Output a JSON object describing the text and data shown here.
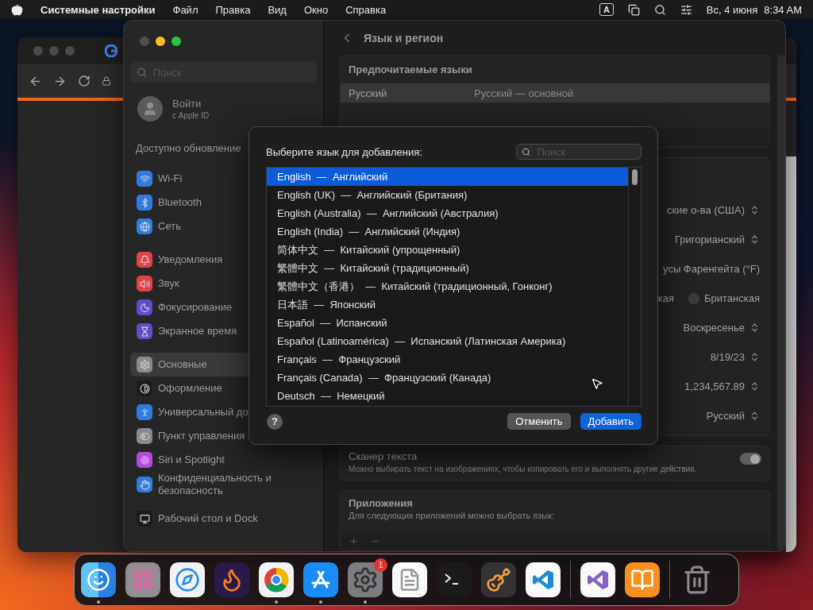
{
  "menu_bar": {
    "app": "Системные настройки",
    "menus": [
      "Файл",
      "Правка",
      "Вид",
      "Окно",
      "Справка"
    ],
    "input_source": "A",
    "date": "Вс, 4 июня",
    "time": "8:34 AM"
  },
  "settings": {
    "search": {
      "placeholder": "Поиск"
    },
    "account": {
      "title": "Войти",
      "subtitle": "с Apple ID"
    },
    "update_notice": "Доступно обновление",
    "sidebar_groups": [
      [
        {
          "label": "Wi-Fi",
          "color": "#2f7de1",
          "selected": false
        },
        {
          "label": "Bluetooth",
          "color": "#2f7de1",
          "selected": false
        },
        {
          "label": "Сеть",
          "color": "#2f7de1",
          "selected": false
        }
      ],
      [
        {
          "label": "Уведомления",
          "color": "#e0444a",
          "selected": false
        },
        {
          "label": "Звук",
          "color": "#e0444a",
          "selected": false
        },
        {
          "label": "Фокусирование",
          "color": "#5d4fc9",
          "selected": false
        },
        {
          "label": "Экранное время",
          "color": "#5d4fc9",
          "selected": false
        }
      ],
      [
        {
          "label": "Основные",
          "color": "#8a8a8e",
          "selected": true
        },
        {
          "label": "Оформление",
          "color": "#1c1c1c",
          "selected": false
        },
        {
          "label": "Универсальный до",
          "color": "#2f7de1",
          "selected": false
        },
        {
          "label": "Пункт управления",
          "color": "#8a8a8e",
          "selected": false
        },
        {
          "label": "Siri и Spotlight",
          "color": "#b24bd8",
          "selected": false
        },
        {
          "label": "Конфиденциальность и безопасность",
          "color": "#2f7de1",
          "selected": false
        }
      ],
      [
        {
          "label": "Рабочий стол и Dock",
          "color": "#1c1c1c",
          "selected": false
        }
      ]
    ],
    "title": "Язык и регион",
    "preferred_languages": {
      "heading": "Предпочитаемые языки",
      "rows": [
        {
          "language": "Русский",
          "note": "Русский — основной",
          "selected": true
        }
      ]
    },
    "region_rows": [
      {
        "kind": "popup",
        "value": "ские о-ва (США)"
      },
      {
        "kind": "popup",
        "value": "Григорианский"
      },
      {
        "kind": "text",
        "value": "усы Фаренгейта (°F)"
      },
      {
        "kind": "radio",
        "value": "кая",
        "option": {
          "label": "Британская",
          "selected": false
        }
      },
      {
        "kind": "popup",
        "value": "Воскресенье"
      },
      {
        "kind": "popup",
        "value": "8/19/23"
      },
      {
        "kind": "popup",
        "value": "1,234,567.89"
      },
      {
        "kind": "popup",
        "value": "Русский"
      }
    ],
    "live_text": {
      "title": "Сканер текста",
      "description": "Можно выбирать текст на изображениях, чтобы копировать его и выполнять другие действия.",
      "on": true
    },
    "apps": {
      "title": "Приложения",
      "description": "Для следующих приложений можно выбрать язык:"
    }
  },
  "dialog": {
    "title": "Выберите язык для добавления:",
    "search": {
      "placeholder": "Поиск"
    },
    "languages": [
      {
        "label": "English  —  Английский",
        "selected": true
      },
      {
        "label": "English (UK)  —  Английский (Британия)",
        "selected": false
      },
      {
        "label": "English (Australia)  —  Английский (Австралия)",
        "selected": false
      },
      {
        "label": "English (India)  —  Английский (Индия)",
        "selected": false
      },
      {
        "label": "简体中文  —  Китайский (упрощенный)",
        "selected": false
      },
      {
        "label": "繁體中文  —  Китайский (традиционный)",
        "selected": false
      },
      {
        "label": "繁體中文（香港）  —  Китайский (традиционный, Гонконг)",
        "selected": false
      },
      {
        "label": "日本語  —  Японский",
        "selected": false
      },
      {
        "label": "Español  —  Испанский",
        "selected": false
      },
      {
        "label": "Español (Latinoamérica)  —  Испанский (Латинская Америка)",
        "selected": false
      },
      {
        "label": "Français  —  Французский",
        "selected": false
      },
      {
        "label": "Français (Canada)  —  Французский (Канада)",
        "selected": false
      },
      {
        "label": "Deutsch  —  Немецкий",
        "selected": false
      }
    ],
    "help": "?",
    "cancel": "Отменить",
    "add": "Добавить"
  },
  "dock": [
    {
      "kind": "app",
      "running": true
    },
    {
      "kind": "app",
      "running": false
    },
    {
      "kind": "app",
      "running": false
    },
    {
      "kind": "app",
      "running": false
    },
    {
      "kind": "app",
      "running": true
    },
    {
      "kind": "app",
      "running": true
    },
    {
      "kind": "app",
      "running": true,
      "badge": "1"
    },
    {
      "kind": "app",
      "running": false
    },
    {
      "kind": "app",
      "running": false
    },
    {
      "kind": "app",
      "running": false
    },
    {
      "kind": "app",
      "running": false
    },
    {
      "kind": "separator"
    },
    {
      "kind": "app",
      "running": false
    },
    {
      "kind": "app",
      "running": false
    },
    {
      "kind": "separator"
    },
    {
      "kind": "app",
      "running": false
    }
  ]
}
